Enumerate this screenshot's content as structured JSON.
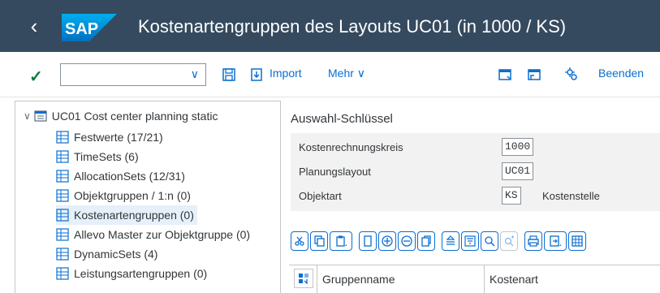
{
  "header": {
    "title": "Kostenartengruppen des Layouts UC01 (in 1000 / KS)",
    "logo_text": "SAP"
  },
  "toolbar": {
    "command_value": "",
    "import_label": "Import",
    "more_label": "Mehr",
    "exit_label": "Beenden"
  },
  "tree": {
    "root": "UC01 Cost center planning static",
    "items": [
      {
        "label": "Festwerte (17/21)"
      },
      {
        "label": "TimeSets (6)"
      },
      {
        "label": "AllocationSets (12/31)"
      },
      {
        "label": "Objektgruppen / 1:n (0)"
      },
      {
        "label": "Kostenartengruppen (0)"
      },
      {
        "label": "Allevo Master zur Objektgruppe (0)"
      },
      {
        "label": "DynamicSets (4)"
      },
      {
        "label": "Leistungsartengruppen (0)"
      }
    ]
  },
  "selection": {
    "title": "Auswahl-Schlüssel",
    "fields": [
      {
        "label": "Kostenrechnungskreis",
        "value": "1000",
        "desc": ""
      },
      {
        "label": "Planungslayout",
        "value": "UC01",
        "desc": ""
      },
      {
        "label": "Objektart",
        "value": "KS",
        "desc": "Kostenstelle"
      }
    ]
  },
  "grid": {
    "columns": [
      "Gruppenname",
      "Kostenart"
    ]
  },
  "colors": {
    "shell": "#354a5f",
    "accent": "#0a6ed1",
    "success": "#107e3e"
  }
}
